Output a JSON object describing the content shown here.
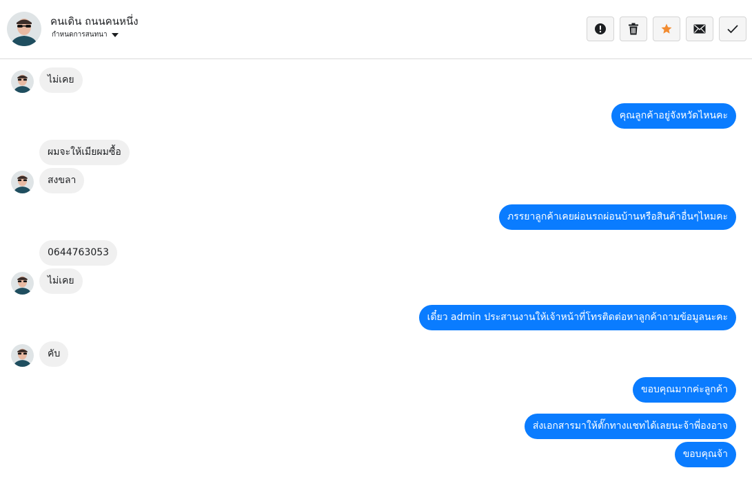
{
  "header": {
    "contact_name": "คนเดิน ถนนคนหนึ่ง",
    "assign_label": "กำหนดการสนทนา"
  },
  "actions": [
    {
      "name": "report-button",
      "icon": "alert-circle-icon"
    },
    {
      "name": "delete-button",
      "icon": "trash-icon"
    },
    {
      "name": "star-button",
      "icon": "star-icon",
      "color": "#f28b30"
    },
    {
      "name": "mail-button",
      "icon": "envelope-icon"
    },
    {
      "name": "done-button",
      "icon": "check-icon"
    }
  ],
  "colors": {
    "outgoing_bubble": "#0a7cff",
    "incoming_bubble": "#f0f0f0",
    "star": "#f28b30"
  },
  "messages": [
    {
      "direction": "in",
      "text": "ไม่เคย"
    },
    {
      "direction": "out",
      "text": "คุณลูกค้าอยู่จังหวัดไหนคะ"
    },
    {
      "direction": "in",
      "text": "ผมจะให้เมียผมซื้อ"
    },
    {
      "direction": "in",
      "text": "สงขลา"
    },
    {
      "direction": "out",
      "text": "ภรรยาลูกค้าเคยผ่อนรถผ่อนบ้านหรือสินค้าอื่นๆไหมคะ"
    },
    {
      "direction": "in",
      "text": "0644763053"
    },
    {
      "direction": "in",
      "text": "ไม่เคย"
    },
    {
      "direction": "out",
      "text": "เดี๋ยว admin ประสานงานให้เจ้าหน้าที่โทรติดต่อหาลูกค้าถามข้อมูลนะคะ"
    },
    {
      "direction": "in",
      "text": "คับ"
    },
    {
      "direction": "out",
      "text": "ขอบคุณมากค่ะลูกค้า"
    },
    {
      "direction": "out",
      "text": "ส่งเอกสารมาให้ตั๊กทางแชทได้เลยนะจ้าพี่องอาจ"
    },
    {
      "direction": "out",
      "text": "ขอบคุณจ้า"
    }
  ]
}
